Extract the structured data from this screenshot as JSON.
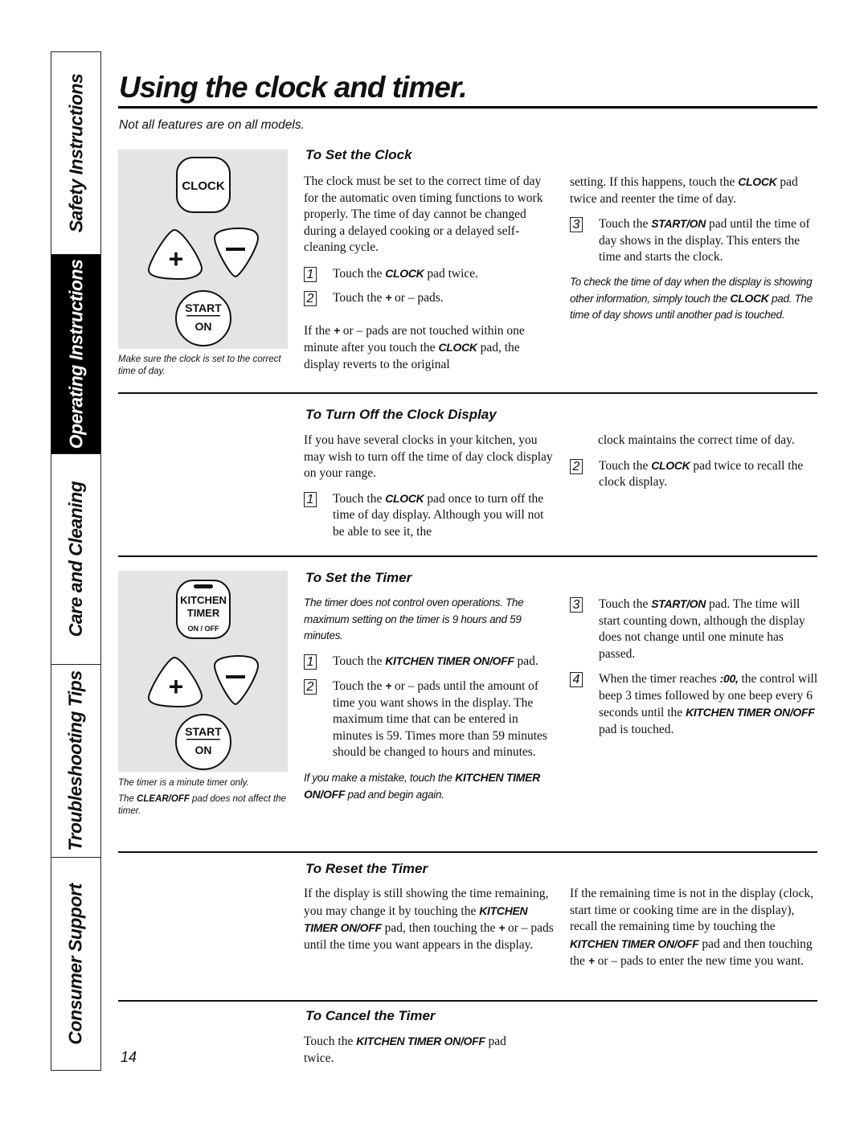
{
  "sidebar": {
    "tabs": [
      {
        "label": "Safety Instructions",
        "active": false
      },
      {
        "label": "Operating Instructions",
        "active": true
      },
      {
        "label": "Care and Cleaning",
        "active": false
      },
      {
        "label": "Troubleshooting Tips",
        "active": false
      },
      {
        "label": "Consumer Support",
        "active": false
      }
    ]
  },
  "header": {
    "title": "Using the clock and timer.",
    "subtitle": "Not all features are on all models."
  },
  "clock_panel": {
    "pads": {
      "clock": "CLOCK",
      "plus": "+",
      "minus": "–",
      "start": "START",
      "on": "ON"
    },
    "caption": "Make sure the clock is set to the correct time of day."
  },
  "timer_panel": {
    "pads": {
      "kitchen": "KITCHEN",
      "timer": "TIMER",
      "onoff": "ON / OFF",
      "plus": "+",
      "minus": "–",
      "start": "START",
      "on": "ON"
    },
    "captions": [
      "The timer is a minute timer only.",
      {
        "pre": "The ",
        "kw": "CLEAR/OFF",
        "post": " pad does not affect the timer."
      }
    ]
  },
  "sections": {
    "set_clock": {
      "heading": "To Set the Clock",
      "intro": "The clock must be set to the correct time of day for the automatic oven timing functions to work properly. The time of day cannot be changed during a delayed cooking or a delayed self-cleaning cycle.",
      "steps": [
        {
          "num": "1",
          "pre": "Touch the ",
          "kw": "CLOCK",
          "post": " pad twice."
        },
        {
          "num": "2",
          "pre": "Touch the ",
          "kw": "+",
          "post": " or – pads."
        }
      ],
      "warning": {
        "pre": "If the ",
        "kw1": "+",
        "mid": " or – pads are not touched within one minute after you touch the ",
        "kw2": "CLOCK",
        "post": " pad, the display reverts to the original setting. If this happens, touch the ",
        "kw3": "CLOCK",
        "end": " pad twice and reenter the time of day."
      },
      "warning_col1": {
        "pre": "If the ",
        "kw1": "+",
        "mid": " or – pads are not touched within one minute after you touch the ",
        "kw2": "CLOCK",
        "post": " pad, the display reverts to the original"
      },
      "warning_col2": {
        "pre": "setting. If this happens, touch the ",
        "kw": "CLOCK",
        "post": " pad twice and reenter the time of day."
      },
      "step3": {
        "num": "3",
        "pre": "Touch the ",
        "kw": "START/ON",
        "post": " pad until the time of day shows in the display. This enters the time and starts the clock."
      },
      "note": {
        "pre": "To check the time of day when the display is showing other information, simply touch the ",
        "kw": "CLOCK",
        "post": " pad. The time of day shows until another pad is touched."
      }
    },
    "turn_off_display": {
      "heading": "To Turn Off the Clock Display",
      "intro": "If you have several clocks in your kitchen, you may wish to turn off the time of day clock display on your range.",
      "step1": {
        "num": "1",
        "pre": "Touch the ",
        "kw": "CLOCK",
        "post": " pad once to turn off the time of day display. Although you will not be able to see it, the"
      },
      "step1_cont": "clock maintains the correct time of day.",
      "step2": {
        "num": "2",
        "pre": "Touch the ",
        "kw": "CLOCK",
        "post": " pad twice to recall the clock display."
      }
    },
    "set_timer": {
      "heading": "To Set the Timer",
      "note": "The timer does not control oven operations. The maximum setting on the timer is 9 hours and 59 minutes.",
      "step1": {
        "num": "1",
        "pre": "Touch the ",
        "kw": "KITCHEN TIMER ON/OFF",
        "post": " pad."
      },
      "step2": {
        "num": "2",
        "pre": "Touch the ",
        "kw": "+",
        "post": " or – pads until the amount of time you want shows in the display. The maximum time that can be entered in minutes is 59. Times more than 59 minutes should be changed to hours and minutes."
      },
      "mistake": {
        "pre": "If you make a mistake, touch the ",
        "kw": "KITCHEN TIMER ON/OFF",
        "post": " pad and begin again."
      },
      "step3": {
        "num": "3",
        "pre": "Touch the ",
        "kw": "START/ON",
        "post": " pad. The time will start counting down, although the display does not change until one minute has passed."
      },
      "step4": {
        "num": "4",
        "pre": "When the timer reaches ",
        "kw": ":00,",
        "mid": " the control will beep 3 times followed by one beep every 6 seconds until the ",
        "kw2": "KITCHEN TIMER ON/OFF",
        "post": " pad is touched."
      }
    },
    "reset_timer": {
      "heading": "To Reset the Timer",
      "col1": {
        "pre": "If the display is still showing the time remaining, you may change it by touching the ",
        "kw": "KITCHEN TIMER ON/OFF",
        "mid": " pad, then touching the ",
        "kw2": "+",
        "post": " or – pads until the time you want appears in the display."
      },
      "col2": {
        "pre": "If the remaining time is not in the display (clock, start time or cooking time are in the display), recall the remaining time by touching the ",
        "kw": "KITCHEN TIMER ON/OFF",
        "mid": " pad and then touching the ",
        "kw2": "+",
        "post": " or – pads to enter the new time you want."
      }
    },
    "cancel_timer": {
      "heading": "To Cancel the Timer",
      "text": {
        "pre": "Touch the ",
        "kw": "KITCHEN TIMER ON/OFF",
        "post": " pad twice."
      }
    }
  },
  "page_number": "14"
}
